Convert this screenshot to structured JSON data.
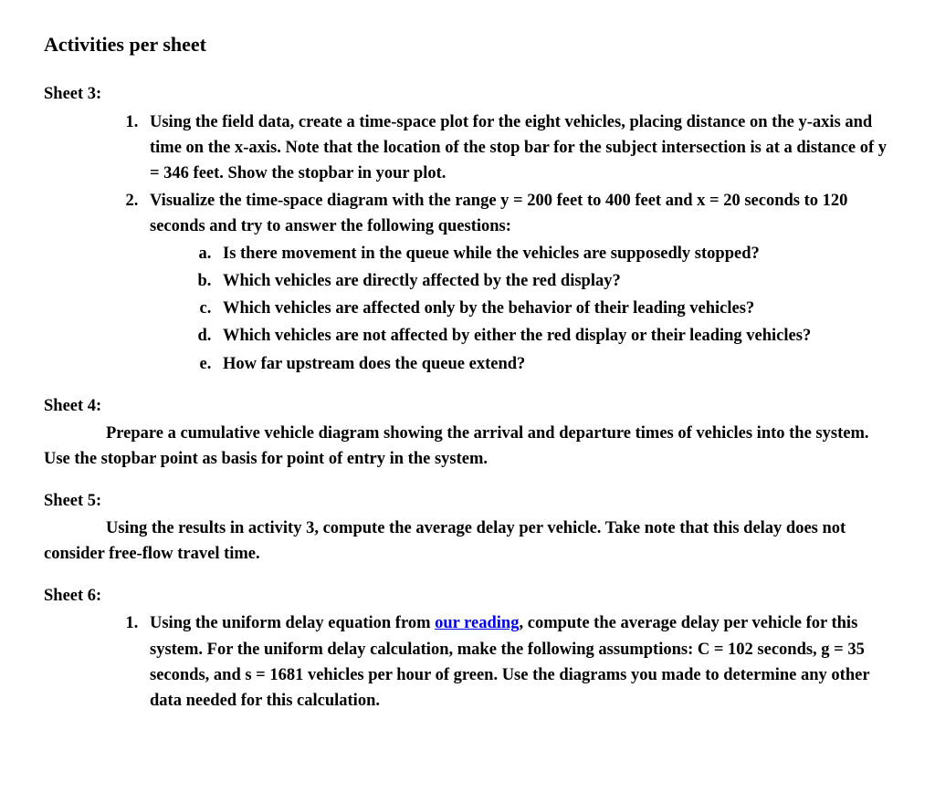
{
  "page_title": "Activities per sheet",
  "sheet3": {
    "heading": "Sheet 3:",
    "items": [
      "Using the field data, create a time-space plot for the eight vehicles, placing distance on the y-axis and time on the x-axis. Note that the location of the stop bar for the subject intersection is at a distance of y = 346 feet. Show the stopbar in your plot.",
      "Visualize the time-space diagram with the range y = 200 feet to 400 feet and x = 20 seconds to 120 seconds and try to answer the following questions:"
    ],
    "subitems": [
      "Is there movement in the queue while the vehicles are supposedly stopped?",
      "Which vehicles are directly affected by the red display?",
      "Which vehicles are affected only by the behavior of their leading vehicles?",
      "Which vehicles are not affected by either the red display or their leading vehicles?",
      "How far upstream does the queue extend?"
    ]
  },
  "sheet4": {
    "heading": "Sheet 4:",
    "body": "Prepare a cumulative vehicle diagram showing the arrival and departure times of vehicles into the system. Use the stopbar point as basis for point of entry in the system."
  },
  "sheet5": {
    "heading": "Sheet 5:",
    "body": "Using the results in activity 3, compute the average delay per vehicle. Take note that this delay does not consider free-flow travel time."
  },
  "sheet6": {
    "heading": "Sheet 6:",
    "item_before_link": "Using the uniform delay equation from ",
    "link_text": "our reading",
    "item_after_link": ", compute the average delay per vehicle for this system. For the uniform delay calculation, make the following assumptions: C = 102 seconds, g = 35 seconds, and s = 1681 vehicles per hour of green. Use the diagrams you made to determine any other data needed for this calculation."
  }
}
